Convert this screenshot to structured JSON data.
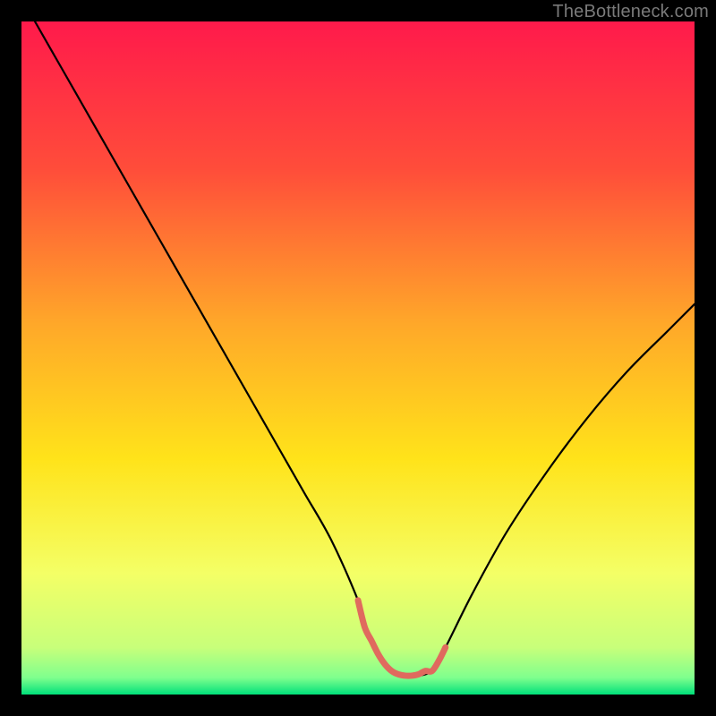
{
  "watermark": "TheBottleneck.com",
  "chart_data": {
    "type": "line",
    "title": "",
    "xlabel": "",
    "ylabel": "",
    "xlim": [
      0,
      100
    ],
    "ylim": [
      0,
      100
    ],
    "grid": false,
    "legend": false,
    "gradient_stops": [
      {
        "offset": 0.0,
        "color": "#ff1a4b"
      },
      {
        "offset": 0.22,
        "color": "#ff4d3a"
      },
      {
        "offset": 0.45,
        "color": "#ffa829"
      },
      {
        "offset": 0.65,
        "color": "#ffe31a"
      },
      {
        "offset": 0.82,
        "color": "#f4ff66"
      },
      {
        "offset": 0.93,
        "color": "#c8ff7a"
      },
      {
        "offset": 0.975,
        "color": "#7fff8e"
      },
      {
        "offset": 1.0,
        "color": "#00e07a"
      }
    ],
    "series": [
      {
        "name": "bottleneck-curve",
        "color": "#000000",
        "x": [
          2,
          6,
          10,
          14,
          18,
          22,
          26,
          30,
          34,
          38,
          42,
          46,
          50,
          52,
          55,
          58,
          61,
          63,
          67,
          72,
          78,
          84,
          90,
          96,
          100
        ],
        "y": [
          100,
          93,
          86,
          79,
          72,
          65,
          58,
          51,
          44,
          37,
          30,
          23,
          14,
          8,
          3.5,
          2.8,
          3.5,
          7,
          15,
          24,
          33,
          41,
          48,
          54,
          58
        ]
      },
      {
        "name": "valley-highlight",
        "color": "#e06a5e",
        "x": [
          50,
          51,
          52,
          53,
          54,
          55,
          56,
          57,
          58,
          59,
          60,
          61,
          62,
          63
        ],
        "y": [
          14,
          10,
          8,
          6,
          4.5,
          3.5,
          3,
          2.8,
          2.8,
          3,
          3.5,
          3.5,
          5,
          7
        ]
      }
    ]
  }
}
